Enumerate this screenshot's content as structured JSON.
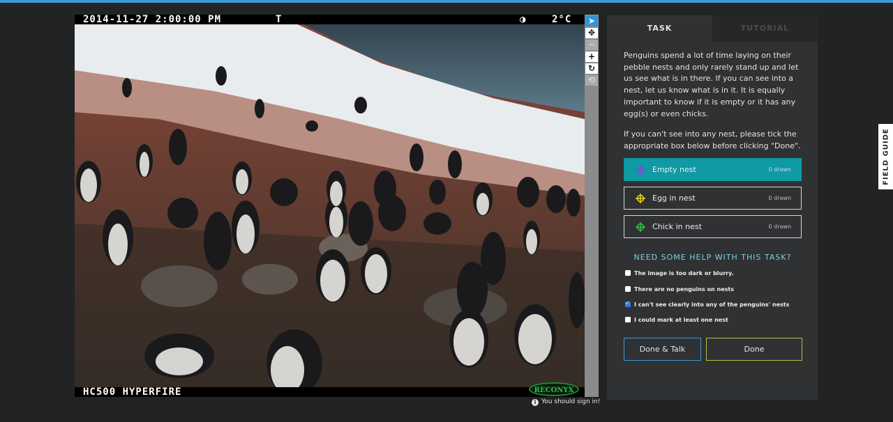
{
  "camera": {
    "timestamp": "2014-11-27 2:00:00 PM",
    "flag": "T",
    "moon": "◑",
    "temperature": "2°C",
    "model": "HC500 HYPERFIRE",
    "brand": "RECONYX"
  },
  "toolbar": {
    "tools": [
      {
        "icon": "pointer-icon",
        "glyph": "➤"
      },
      {
        "icon": "move-icon",
        "glyph": "✥"
      },
      {
        "icon": "zoom-out-icon",
        "glyph": "−"
      },
      {
        "icon": "zoom-in-icon",
        "glyph": "+"
      },
      {
        "icon": "rotate-icon",
        "glyph": "↻"
      },
      {
        "icon": "reset-icon",
        "glyph": "⟲"
      }
    ]
  },
  "signin_notice": "You should sign in!",
  "tabs": {
    "task": "TASK",
    "tutorial": "TUTORIAL"
  },
  "instructions": {
    "p1": "Penguins spend a lot of time laying on their pebble nests and only rarely stand up and let us see what is in there. If you can see into a nest, let us know what is in it. It is equally important to know if it is empty or it has any egg(s) or even chicks.",
    "p2": "If you can't see into any nest, please tick the appropriate box below before clicking \"Done\"."
  },
  "drawing_tools": [
    {
      "label": "Empty nest",
      "count": "0 drawn",
      "color": "#7c4dd8",
      "selected": true
    },
    {
      "label": "Egg in nest",
      "count": "0 drawn",
      "color": "#e6d21e",
      "selected": false
    },
    {
      "label": "Chick in nest",
      "count": "0 drawn",
      "color": "#2fbf3f",
      "selected": false
    }
  ],
  "help": {
    "title": "NEED SOME HELP WITH THIS TASK?",
    "options": [
      {
        "label": "The image is too dark or blurry.",
        "checked": false
      },
      {
        "label": "There are no penguins on nests",
        "checked": false
      },
      {
        "label": "I can't see clearly into any of the penguins' nests",
        "checked": true
      },
      {
        "label": "I could mark at least one nest",
        "checked": false
      }
    ]
  },
  "buttons": {
    "done_talk": "Done & Talk",
    "done": "Done"
  },
  "field_guide": "FIELD GUIDE",
  "colors": {
    "accent": "#3d9ad6",
    "selected_tool": "#0f9aa4",
    "done_border": "#b5c43a",
    "help_title": "#7fd0de"
  }
}
